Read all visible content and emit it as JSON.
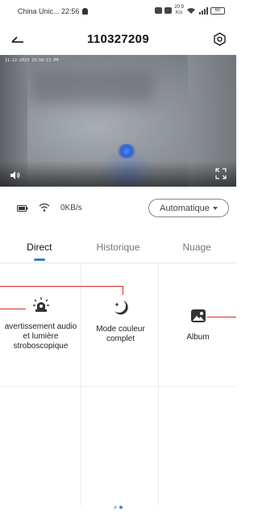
{
  "status_bar": {
    "carrier_time": "China Unic... 22:56",
    "net_speed_value": "20.9",
    "net_speed_unit": "K/s",
    "battery": "60"
  },
  "header": {
    "title": "110327209"
  },
  "video": {
    "timestamp": "11-12-2023 10:58:13 PM"
  },
  "info": {
    "speed": "0KB/s",
    "quality": "Automatique"
  },
  "tabs": [
    {
      "label": "Direct",
      "active": true
    },
    {
      "label": "Historique",
      "active": false
    },
    {
      "label": "Nuage",
      "active": false
    }
  ],
  "features": [
    {
      "label": "avertissement audio et lumière stroboscopique",
      "icon": "siren-icon"
    },
    {
      "label": "Mode couleur complet",
      "icon": "moon-icon"
    },
    {
      "label": "Album",
      "icon": "image-icon"
    }
  ],
  "colors": {
    "accent": "#3a7fc4",
    "annotation": "#d42a2a"
  }
}
